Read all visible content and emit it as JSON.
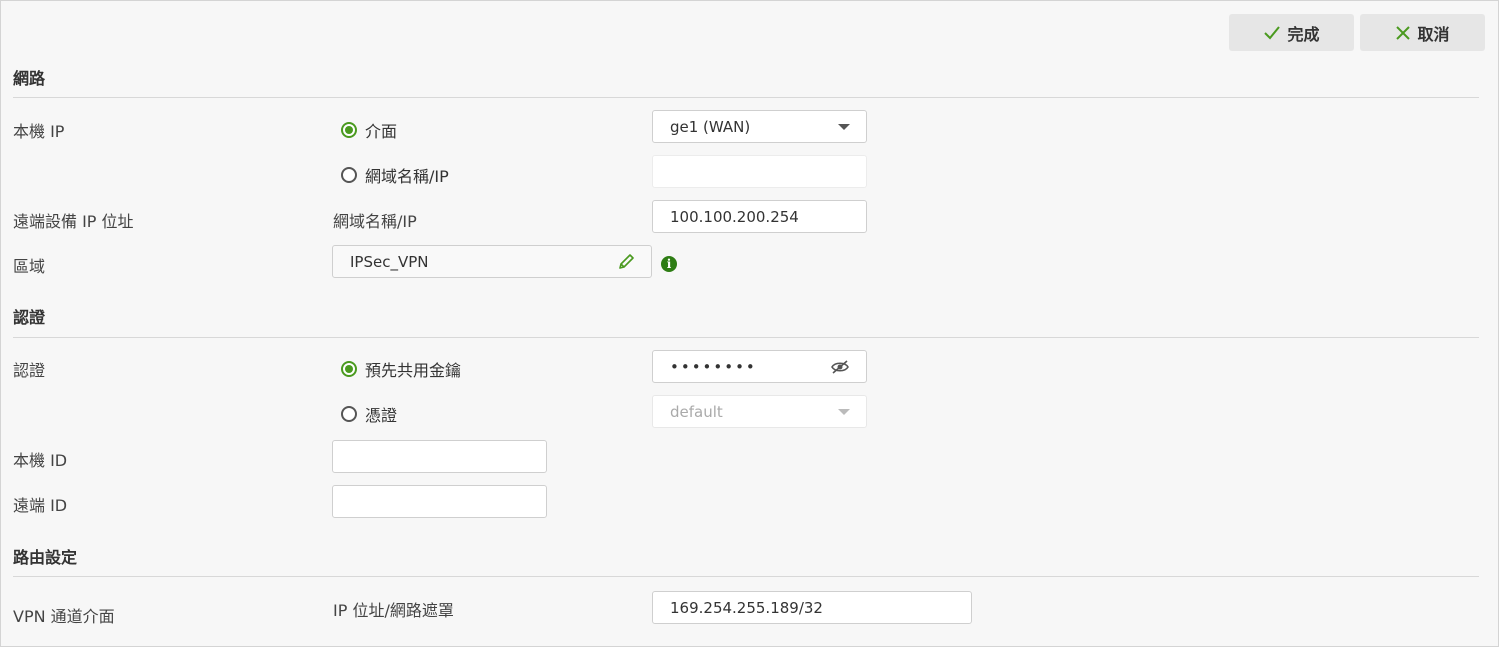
{
  "toolbar": {
    "done_label": "完成",
    "cancel_label": "取消"
  },
  "sections": {
    "network": "網路",
    "auth": "認證",
    "routing": "路由設定"
  },
  "network": {
    "local_ip_label": "本機 IP",
    "radio_interface_label": "介面",
    "radio_domain_label": "網域名稱/IP",
    "interface_select_value": "ge1 (WAN)",
    "local_domain_value": "",
    "remote_ip_label": "遠端設備 IP 位址",
    "remote_type_label": "網域名稱/IP",
    "remote_ip_value": "100.100.200.254",
    "zone_label": "區域",
    "zone_value": "IPSec_VPN",
    "zone_info_glyph": "i"
  },
  "auth": {
    "auth_label": "認證",
    "radio_psk_label": "預先共用金鑰",
    "psk_value": "••••••••",
    "radio_cert_label": "憑證",
    "cert_select_value": "default",
    "local_id_label": "本機 ID",
    "local_id_value": "",
    "remote_id_label": "遠端 ID",
    "remote_id_value": ""
  },
  "routing": {
    "vti_label": "VPN 通道介面",
    "ip_mask_label": "IP 位址/網路遮罩",
    "ip_mask_value": "169.254.255.189/32"
  },
  "colors": {
    "accent_green": "#4a9a1f",
    "info_green": "#2e7d14",
    "panel_bg": "#f7f7f7",
    "button_bg": "#e6e6e6"
  },
  "icons": {
    "done": "check-icon",
    "cancel": "close-icon",
    "zone_edit": "pencil-icon",
    "zone_info": "info-icon",
    "psk_toggle": "eye-slash-icon",
    "dropdown": "caret-down-icon"
  }
}
